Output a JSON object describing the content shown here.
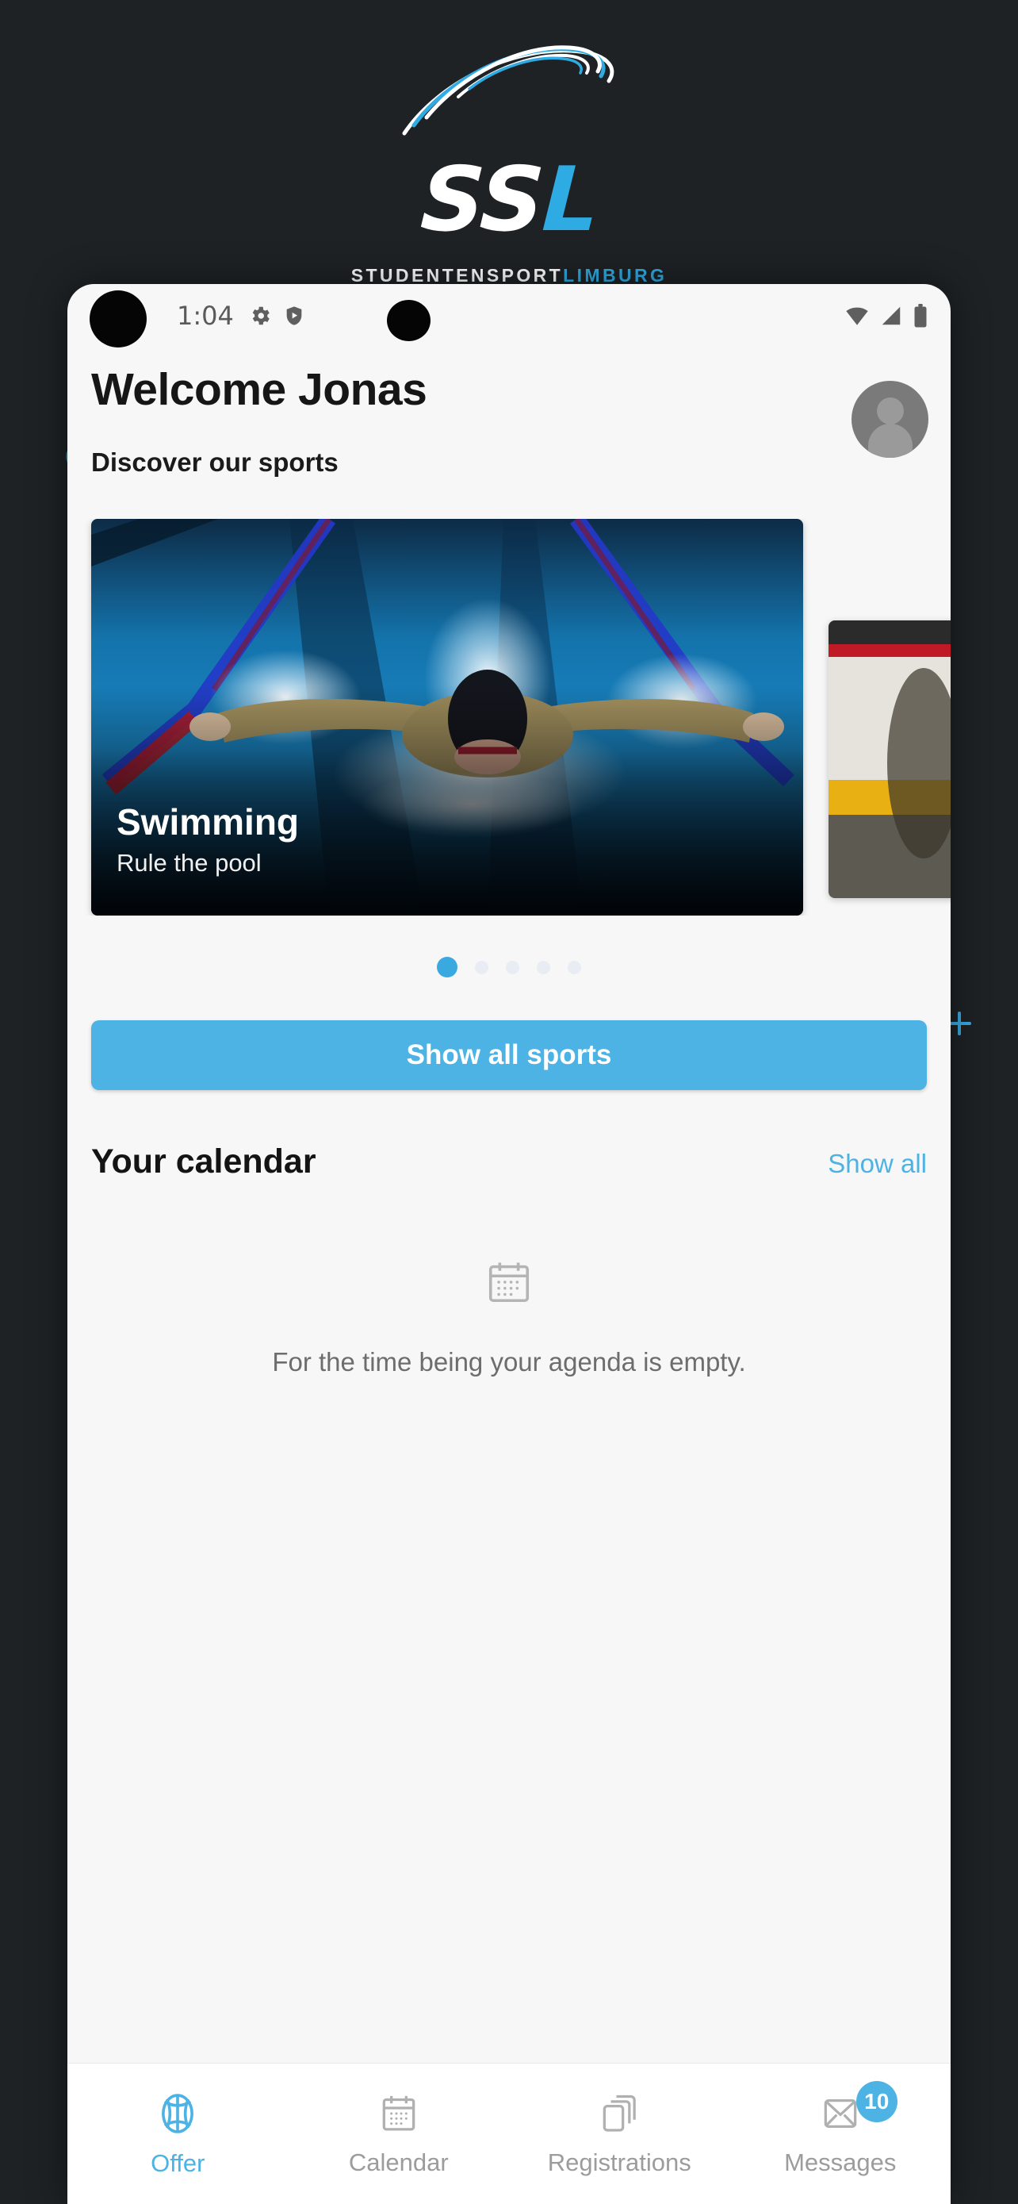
{
  "brand": {
    "logo_text_part1": "SS",
    "logo_text_part2": "L",
    "tagline_part1": "STUDENTENSPORT",
    "tagline_part2": "LIMBURG",
    "accent_color": "#2eabe2",
    "backdrop_color": "#1e2225"
  },
  "statusbar": {
    "time": "1:04",
    "icons_left": [
      "gear-icon",
      "play-protect-shield-icon"
    ],
    "icons_right": [
      "wifi-icon",
      "cellular-signal-icon",
      "battery-icon"
    ]
  },
  "header": {
    "welcome": "Welcome Jonas",
    "subtitle": "Discover our sports",
    "avatar": "user-avatar"
  },
  "carousel": {
    "active_index": 0,
    "dot_count": 5,
    "cards": [
      {
        "title": "Swimming",
        "subtitle": "Rule the pool",
        "image": "swimmer-butterfly-stroke-pool"
      },
      {
        "title": "",
        "subtitle": "",
        "image": "next-sport-photo"
      }
    ]
  },
  "actions": {
    "show_all_sports": "Show all sports"
  },
  "calendar": {
    "title": "Your calendar",
    "show_all": "Show all",
    "empty_icon": "calendar-icon",
    "empty_message": "For the time being your agenda is empty."
  },
  "bottomnav": {
    "items": [
      {
        "label": "Offer",
        "icon": "basketball-icon",
        "active": true,
        "badge": ""
      },
      {
        "label": "Calendar",
        "icon": "calendar-icon",
        "active": false,
        "badge": ""
      },
      {
        "label": "Registrations",
        "icon": "cards-stack-icon",
        "active": false,
        "badge": ""
      },
      {
        "label": "Messages",
        "icon": "envelope-icon",
        "active": false,
        "badge": "10"
      }
    ]
  }
}
